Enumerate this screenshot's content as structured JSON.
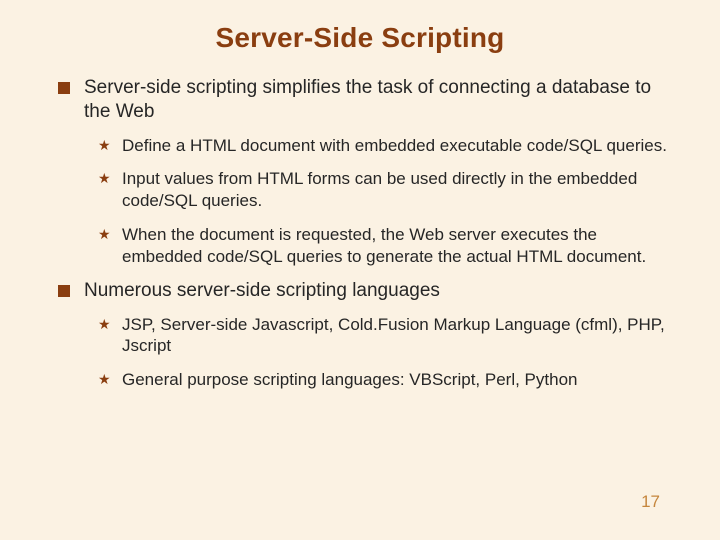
{
  "title": "Server-Side Scripting",
  "bullets": [
    {
      "text": "Server-side scripting simplifies the task of connecting a database to the Web",
      "sub": [
        "Define a HTML document with embedded executable code/SQL queries.",
        "Input values from HTML forms can be used directly in the embedded code/SQL queries.",
        "When the document is requested, the Web server executes the embedded code/SQL queries to generate the actual HTML document."
      ]
    },
    {
      "text": "Numerous server-side scripting languages",
      "sub": [
        "JSP, Server-side Javascript, Cold.Fusion Markup Language (cfml), PHP, Jscript",
        "General purpose scripting languages: VBScript, Perl, Python"
      ]
    }
  ],
  "page_number": "17"
}
